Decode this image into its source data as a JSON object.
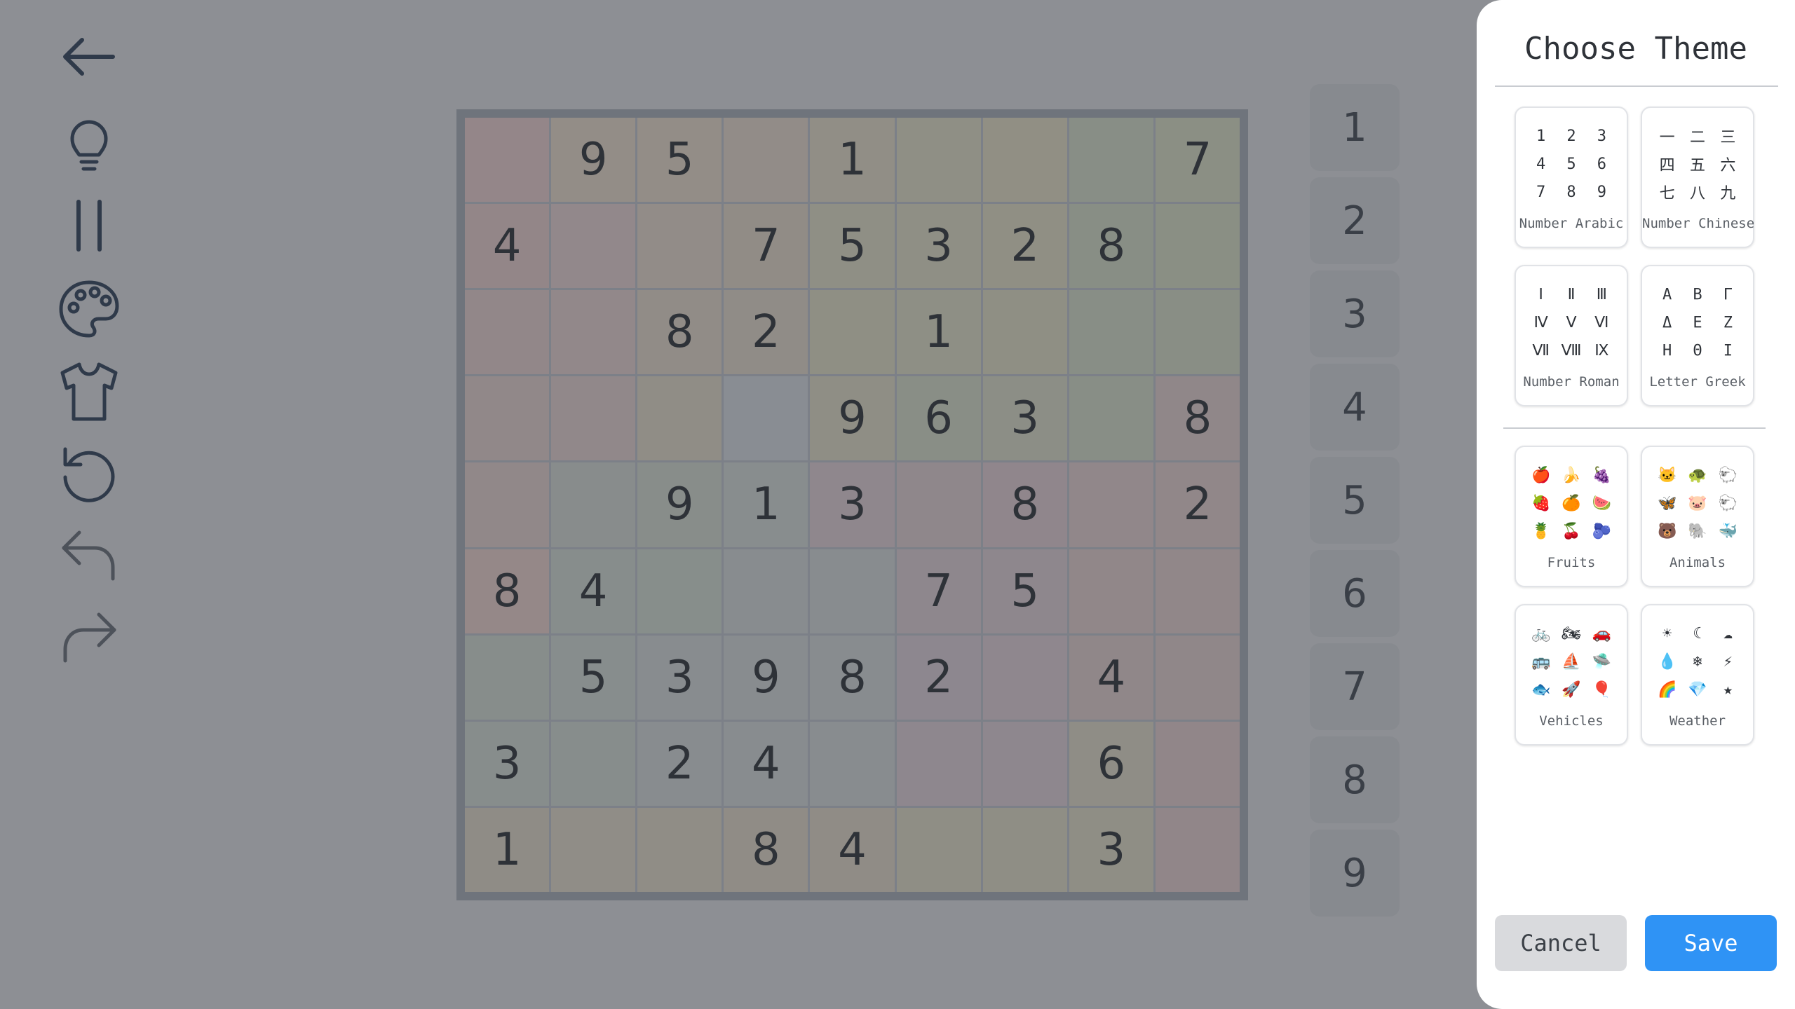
{
  "toolbar": {
    "icons": [
      "back-arrow-icon",
      "lightbulb-hint-icon",
      "pause-icon",
      "palette-icon",
      "shirt-icon",
      "restart-icon",
      "undo-icon",
      "redo-icon"
    ]
  },
  "board": {
    "cells": [
      [
        "",
        "9",
        "5",
        "",
        "1",
        "",
        "",
        "",
        "7"
      ],
      [
        "4",
        "",
        "",
        "7",
        "5",
        "3",
        "2",
        "8",
        ""
      ],
      [
        "",
        "",
        "8",
        "2",
        "",
        "1",
        "",
        "",
        ""
      ],
      [
        "",
        "",
        "",
        "",
        "9",
        "6",
        "3",
        "",
        "8"
      ],
      [
        "",
        "",
        "9",
        "1",
        "3",
        "",
        "8",
        "",
        "2"
      ],
      [
        "8",
        "4",
        "",
        "",
        "",
        "7",
        "5",
        "",
        ""
      ],
      [
        "",
        "5",
        "3",
        "9",
        "8",
        "2",
        "",
        "4",
        ""
      ],
      [
        "3",
        "",
        "2",
        "4",
        "",
        "",
        "",
        "6",
        ""
      ],
      [
        "1",
        "",
        "",
        "8",
        "4",
        "",
        "",
        "3",
        ""
      ]
    ],
    "tints": [
      [
        "#948689",
        "#938d87",
        "#938d87",
        "#928c88",
        "#918e86",
        "#8f8f85",
        "#918f84",
        "#888e86",
        "#8b8f84"
      ],
      [
        "#938688",
        "#92888b",
        "#928c88",
        "#918c86",
        "#8f8f85",
        "#8f8f85",
        "#908f84",
        "#888e85",
        "#8a8f84"
      ],
      [
        "#928789",
        "#92888a",
        "#918c87",
        "#908c87",
        "#8f8f84",
        "#8e8f85",
        "#8f8f84",
        "#888e86",
        "#898e85"
      ],
      [
        "#918889",
        "#91888a",
        "#908d86",
        "#898d93",
        "#8f8e85",
        "#898e86",
        "#8c8e86",
        "#888e86",
        "#908789"
      ],
      [
        "#918889",
        "#888c8c",
        "#888d8a",
        "#888d8e",
        "#8f878d",
        "#8f878b",
        "#90868c",
        "#91878a",
        "#918789"
      ],
      [
        "#958888",
        "#878d8c",
        "#878e8b",
        "#888c8f",
        "#888c8f",
        "#8e878d",
        "#8e878d",
        "#918789",
        "#918789"
      ],
      [
        "#878d8b",
        "#878d8d",
        "#888c8f",
        "#888c8f",
        "#888c8f",
        "#8d878f",
        "#8f878e",
        "#908789",
        "#908789"
      ],
      [
        "#878d8c",
        "#878d8c",
        "#888c8f",
        "#888c8f",
        "#888c8f",
        "#8e878e",
        "#8e878e",
        "#8f8d86",
        "#918689"
      ],
      [
        "#8f8c86",
        "#908d87",
        "#908d86",
        "#908c86",
        "#908c86",
        "#8f8e85",
        "#8f8e85",
        "#8f8e85",
        "#918689"
      ]
    ]
  },
  "numpad": [
    "1",
    "2",
    "3",
    "4",
    "5",
    "6",
    "7",
    "8",
    "9"
  ],
  "panel": {
    "title": "Choose Theme",
    "themes": [
      {
        "label": "Number Arabic",
        "glyphs": [
          "1",
          "2",
          "3",
          "4",
          "5",
          "6",
          "7",
          "8",
          "9"
        ]
      },
      {
        "label": "Number Chinese",
        "glyphs": [
          "一",
          "二",
          "三",
          "四",
          "五",
          "六",
          "七",
          "八",
          "九"
        ]
      },
      {
        "label": "Number Roman",
        "glyphs": [
          "Ⅰ",
          "Ⅱ",
          "Ⅲ",
          "Ⅳ",
          "Ⅴ",
          "Ⅵ",
          "Ⅶ",
          "Ⅷ",
          "Ⅸ"
        ]
      },
      {
        "label": "Letter Greek",
        "glyphs": [
          "Α",
          "Β",
          "Γ",
          "Δ",
          "Ε",
          "Ζ",
          "Η",
          "Θ",
          "Ι"
        ]
      },
      {
        "label": "Fruits",
        "glyphs": [
          "🍎",
          "🍌",
          "🍇",
          "🍓",
          "🍊",
          "🍉",
          "🍍",
          "🍒",
          "🫐"
        ]
      },
      {
        "label": "Animals",
        "glyphs": [
          "🐱",
          "🐢",
          "🐑",
          "🦋",
          "🐷",
          "🐑",
          "🐻",
          "🐘",
          "🐳"
        ]
      },
      {
        "label": "Vehicles",
        "glyphs": [
          "🚲",
          "🏍",
          "🚗",
          "🚌",
          "⛵",
          "🛸",
          "🐟",
          "🚀",
          "🎈"
        ]
      },
      {
        "label": "Weather",
        "glyphs": [
          "☀",
          "☾",
          "☁",
          "💧",
          "❄",
          "⚡",
          "🌈",
          "💎",
          "★"
        ]
      }
    ],
    "cancel_label": "Cancel",
    "save_label": "Save"
  }
}
